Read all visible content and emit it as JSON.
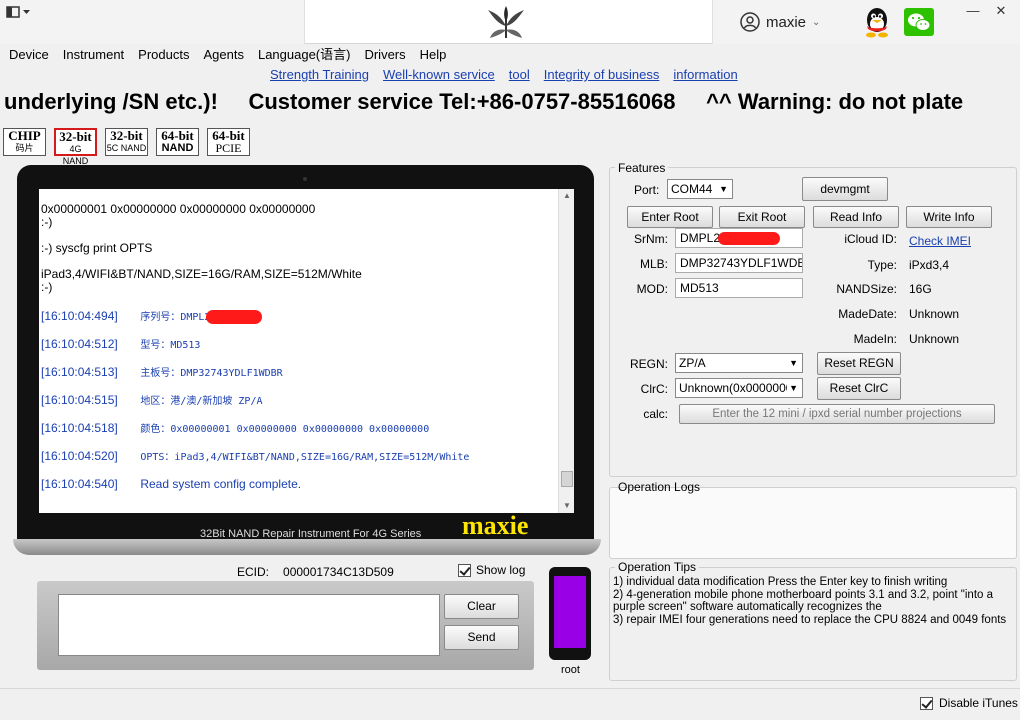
{
  "user": {
    "name": "maxie"
  },
  "menu": [
    "Device",
    "Instrument",
    "Products",
    "Agents",
    "Language(语言)",
    "Drivers",
    "Help"
  ],
  "links": [
    "Strength Training",
    "Well-known service",
    "tool",
    "Integrity of business",
    "information"
  ],
  "marquee": "underlying /SN etc.)!     Customer service Tel:+86-0757-85516068     ^^ Warning: do not plate",
  "chips": [
    {
      "top": "CHIP",
      "bottom": "码片",
      "selected": false
    },
    {
      "top": "32-bit",
      "bottom": "4G NAND",
      "selected": true
    },
    {
      "top": "32-bit",
      "bottom": "5C NAND",
      "selected": false
    },
    {
      "top": "64-bit",
      "bottom": "NAND",
      "selected": false
    },
    {
      "top": "64-bit",
      "bottom": "PCIE",
      "selected": false
    }
  ],
  "log": {
    "lines": {
      "l1": "0x00000001 0x00000000 0x00000000 0x00000000",
      "l2": ":-)",
      "l3": ":-) syscfg print OPTS",
      "l4": "iPad3,4/WIFI&BT/NAND,SIZE=16G/RAM,SIZE=512M/White",
      "l5": ":-)"
    },
    "entries": [
      {
        "ts": "[16:10:04:494]",
        "text": "序列号：DMPL2",
        "redacted": true
      },
      {
        "ts": "[16:10:04:512]",
        "text": "型号：MD513",
        "redacted": false
      },
      {
        "ts": "[16:10:04:513]",
        "text": "主板号：DMP32743YDLF1WDBR",
        "redacted": false
      },
      {
        "ts": "[16:10:04:515]",
        "text": "地区：港/澳/新加坡 ZP/A",
        "redacted": false
      },
      {
        "ts": "[16:10:04:518]",
        "text": "颜色：0x00000001 0x00000000 0x00000000 0x00000000",
        "redacted": false
      },
      {
        "ts": "[16:10:04:520]",
        "text": "OPTS：iPad3,4/WIFI&BT/NAND,SIZE=16G/RAM,SIZE=512M/White",
        "redacted": false,
        "opts": true
      },
      {
        "ts": "[16:10:04:540]",
        "text": "Read system config complete.",
        "redacted": false
      }
    ]
  },
  "laptop": {
    "caption": "32Bit NAND Repair Instrument For 4G Series",
    "brand": "maxie"
  },
  "ecid": {
    "label": "ECID:",
    "value": "000001734C13D509"
  },
  "showlog": {
    "label": "Show log",
    "checked": true
  },
  "console": {
    "clear_label": "Clear",
    "send_label": "Send"
  },
  "phone": {
    "label": "root",
    "screen_color": "#9a00e6"
  },
  "features": {
    "title": "Features",
    "port_label": "Port:",
    "port_value": "COM44",
    "devmgmt_label": "devmgmt",
    "buttons": [
      "Enter Root",
      "Exit Root",
      "Read Info",
      "Write Info"
    ],
    "srnm_label": "SrNm:",
    "srnm_value": "DMPL2",
    "mlb_label": "MLB:",
    "mlb_value": "DMP32743YDLF1WDBR",
    "mod_label": "MOD:",
    "mod_value": "MD513",
    "icloud_label": "iCloud ID:",
    "icloud_link": "Check IMEI",
    "type_label": "Type:",
    "type_value": "iPxd3,4",
    "nandsize_label": "NANDSize:",
    "nandsize_value": "16G",
    "madedate_label": "MadeDate:",
    "madedate_value": "Unknown",
    "madein_label": "MadeIn:",
    "madein_value": "Unknown",
    "regn_label": "REGN:",
    "regn_value": "ZP/A",
    "reset_regn_label": "Reset REGN",
    "clrc_label": "ClrC:",
    "clrc_value": "Unknown(0x0000000",
    "reset_clrc_label": "Reset ClrC",
    "calc_label": "calc:",
    "calc_placeholder": "Enter the 12 mini / ipxd serial number projections"
  },
  "oplogs": {
    "title": "Operation Logs"
  },
  "tips": {
    "title": "Operation Tips",
    "lines": [
      "1) individual data modification Press the Enter key to finish writing",
      "2) 4-generation mobile phone motherboard points 3.1 and 3.2, point \"into a purple screen\" software automatically recognizes the",
      "3) repair IMEI four generations need to replace the CPU 8824 and 0049 fonts"
    ]
  },
  "itunes": {
    "label": "Disable iTunes",
    "checked": true
  },
  "colors": {
    "link": "#1a3fb0",
    "redact": "#ff1a1a",
    "brand": "#ffe600"
  }
}
